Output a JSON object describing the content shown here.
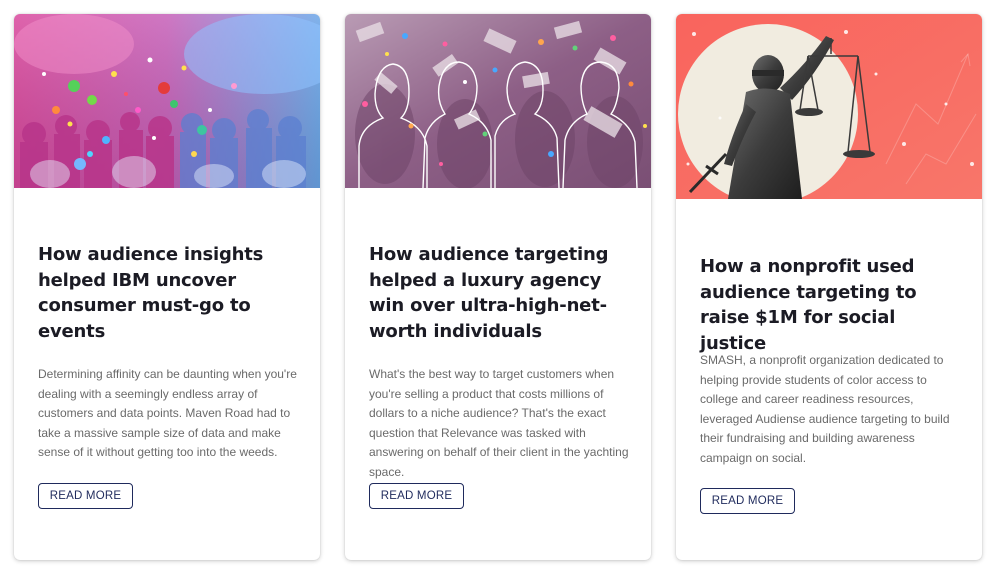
{
  "colors": {
    "title": "#1b1b24",
    "body_text": "#6a6a6a",
    "button_border": "#1f2a5c",
    "card1_hero_pink": "#d84aa0",
    "card1_hero_blue": "#6aa6e8",
    "card2_hero_purple": "#8d5f86",
    "card3_hero_coral": "#f96c63"
  },
  "cards": [
    {
      "hero_icon": "concert-audience-image",
      "title": "How audience insights helped IBM uncover consumer must-go to events",
      "description": "Determining affinity can be daunting when you're dealing with a seemingly endless array of customers and data points. Maven Road had to take a massive sample size of data and make sense of it without getting too into the weeds.",
      "button_label": "READ MORE"
    },
    {
      "hero_icon": "people-money-image",
      "title": "How audience targeting helped a luxury agency win over ultra-high-net-worth individuals",
      "description": "What's the best way to target customers when you're selling a product that costs millions of dollars to a niche audience? That's the exact question that Relevance was tasked with answering on behalf of their client in the yachting space.",
      "button_label": "READ MORE"
    },
    {
      "hero_icon": "lady-justice-image",
      "title": "How a nonprofit used audience targeting to raise $1M for social justice",
      "description": "SMASH, a nonprofit organization dedicated to helping provide students of color access to college and career readiness resources, leveraged Audiense audience targeting to build their fundraising and building awareness campaign on social.",
      "button_label": "READ MORE"
    }
  ]
}
